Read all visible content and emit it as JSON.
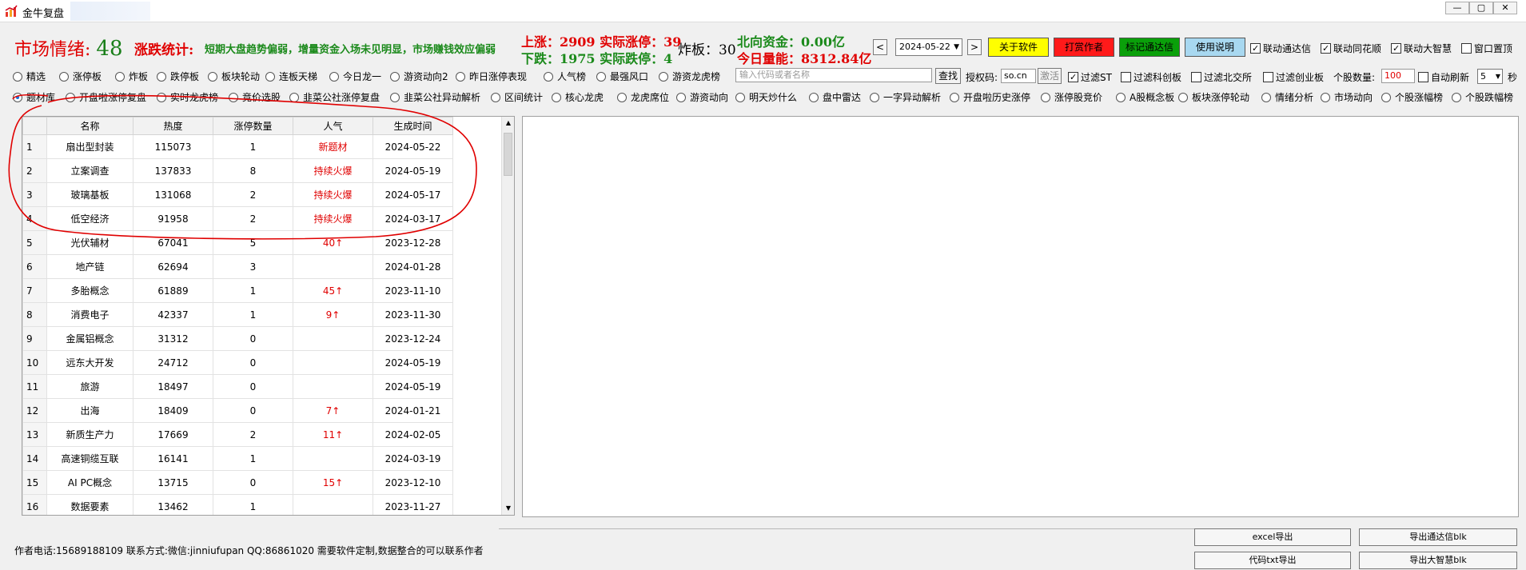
{
  "window": {
    "title": "金牛复盘"
  },
  "status": {
    "sentiment_label": "市场情绪:",
    "sentiment_value": "48",
    "updown_label": "涨跌统计:",
    "updown_text": "短期大盘趋势偏弱，增量资金入场未见明显，市场赚钱效应偏弱",
    "up_line": "上涨：2909 实际涨停：39",
    "down_line": "下跌：1975 实际跌停：4",
    "zhaban": "炸板：30",
    "north_funds": "北向资金：0.00亿",
    "today_volume": "今日量能：8312.84亿"
  },
  "controls": {
    "prev": "<",
    "next": ">",
    "date": "2024-05-22",
    "buttons": [
      "关于软件",
      "打赏作者",
      "标记通达信",
      "使用说明"
    ],
    "link_checks": [
      {
        "label": "联动通达信",
        "checked": true
      },
      {
        "label": "联动同花顺",
        "checked": true
      },
      {
        "label": "联动大智慧",
        "checked": true
      },
      {
        "label": "窗口置顶",
        "checked": false
      }
    ]
  },
  "row1": {
    "radios": [
      "精选",
      "涨停板",
      "炸板",
      "跌停板",
      "板块轮动",
      "连板天梯",
      "今日龙一",
      "游资动向2",
      "昨日涨停表现",
      "人气榜",
      "最强风口",
      "游资龙虎榜"
    ],
    "search_placeholder": "输入代码或者名称",
    "search_button": "查找",
    "auth_label": "授权码:",
    "auth_value": "so.cn",
    "activate": "激活",
    "filters": [
      {
        "label": "过滤ST",
        "checked": true
      },
      {
        "label": "过滤科创板",
        "checked": false
      },
      {
        "label": "过滤北交所",
        "checked": false
      },
      {
        "label": "过滤创业板",
        "checked": false
      }
    ],
    "stock_count_label": "个股数量:",
    "stock_count": "100",
    "auto_refresh": "自动刷新",
    "refresh_interval": "5",
    "seconds": "秒"
  },
  "row2": {
    "radios": [
      "题材库",
      "开盘啦涨停复盘",
      "实时龙虎榜",
      "竞价选股",
      "韭菜公社涨停复盘",
      "韭菜公社异动解析",
      "区间统计",
      "核心龙虎",
      "龙虎席位",
      "游资动向",
      "明天炒什么",
      "盘中雷达",
      "一字异动解析",
      "开盘啦历史涨停",
      "涨停股竞价",
      "A股概念板",
      "板块涨停轮动",
      "情绪分析",
      "市场动向",
      "个股涨幅榜",
      "个股跌幅榜"
    ],
    "selected": 0
  },
  "table": {
    "headers": [
      "名称",
      "热度",
      "涨停数量",
      "人气",
      "生成时间"
    ],
    "rows": [
      [
        "1",
        "扇出型封装",
        "115073",
        "1",
        "新题材",
        "2024-05-22"
      ],
      [
        "2",
        "立案调查",
        "137833",
        "8",
        "持续火爆",
        "2024-05-19"
      ],
      [
        "3",
        "玻璃基板",
        "131068",
        "2",
        "持续火爆",
        "2024-05-17"
      ],
      [
        "4",
        "低空经济",
        "91958",
        "2",
        "持续火爆",
        "2024-03-17"
      ],
      [
        "5",
        "光伏辅材",
        "67041",
        "5",
        "40↑",
        "2023-12-28"
      ],
      [
        "6",
        "地产链",
        "62694",
        "3",
        "",
        "2024-01-28"
      ],
      [
        "7",
        "多胎概念",
        "61889",
        "1",
        "45↑",
        "2023-11-10"
      ],
      [
        "8",
        "消费电子",
        "42337",
        "1",
        "9↑",
        "2023-11-30"
      ],
      [
        "9",
        "金属铝概念",
        "31312",
        "0",
        "",
        "2023-12-24"
      ],
      [
        "10",
        "远东大开发",
        "24712",
        "0",
        "",
        "2024-05-19"
      ],
      [
        "11",
        "旅游",
        "18497",
        "0",
        "",
        "2024-05-19"
      ],
      [
        "12",
        "出海",
        "18409",
        "0",
        "7↑",
        "2024-01-21"
      ],
      [
        "13",
        "新质生产力",
        "17669",
        "2",
        "11↑",
        "2024-02-05"
      ],
      [
        "14",
        "高速铜缆互联",
        "16141",
        "1",
        "",
        "2024-03-19"
      ],
      [
        "15",
        "AI PC概念",
        "13715",
        "0",
        "15↑",
        "2023-12-10"
      ],
      [
        "16",
        "数据要素",
        "13462",
        "1",
        "",
        "2023-11-27"
      ]
    ]
  },
  "footer": {
    "text": "作者电话:15689188109 联系方式:微信:jinniufupan QQ:86861020 需要软件定制,数据整合的可以联系作者",
    "buttons": [
      "excel导出",
      "导出通达信blk",
      "代码txt导出",
      "导出大智慧blk"
    ]
  },
  "colors": {
    "red": "#e00000",
    "green": "#1b8a1b",
    "yellow": "#ffff00",
    "annotation": "#e00000"
  }
}
